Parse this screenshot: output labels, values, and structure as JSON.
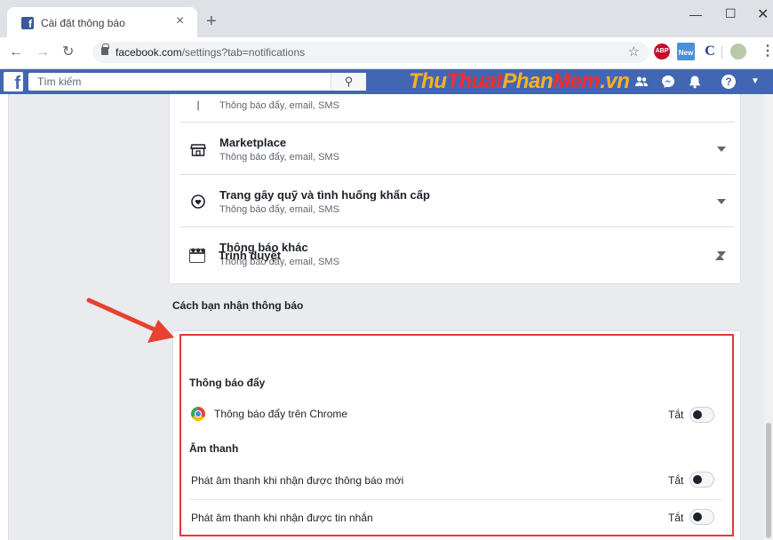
{
  "browser": {
    "tab_title": "Cài đặt thông báo",
    "url_host": "facebook.com",
    "url_path": "/settings?tab=notifications",
    "ext_abp": "ABP",
    "ext_new": "New",
    "ext_c": "C"
  },
  "fb": {
    "search_placeholder": "Tìm kiếm",
    "watermark": [
      "Thu",
      "Thuat",
      "Phan",
      "Mem",
      ".vn"
    ]
  },
  "categories": [
    {
      "title": "",
      "subtitle": "Thông báo đẩy, email, SMS",
      "icon": "partial-icon"
    },
    {
      "title": "Marketplace",
      "subtitle": "Thông báo đẩy, email, SMS",
      "icon": "marketplace-icon"
    },
    {
      "title": "Trang gây quỹ và tình huống khẩn cấp",
      "subtitle": "Thông báo đẩy, email, SMS",
      "icon": "fundraiser-icon"
    },
    {
      "title": "Thông báo khác",
      "subtitle": "Thông báo đẩy, email, SMS",
      "icon": "more-icon"
    }
  ],
  "receive": {
    "section_label": "Cách bạn nhận thông báo",
    "browser": {
      "title": "Trình duyệt",
      "push_heading": "Thông báo đẩy",
      "push_option": "Thông báo đẩy trên Chrome",
      "sound_heading": "Âm thanh",
      "sound_option_1": "Phát âm thanh khi nhận được thông báo mới",
      "sound_option_2": "Phát âm thanh khi nhận được tin nhắn",
      "state_off": "Tắt"
    }
  },
  "colors": {
    "fb_blue": "#4267b2",
    "highlight_red": "#e03a3a"
  }
}
